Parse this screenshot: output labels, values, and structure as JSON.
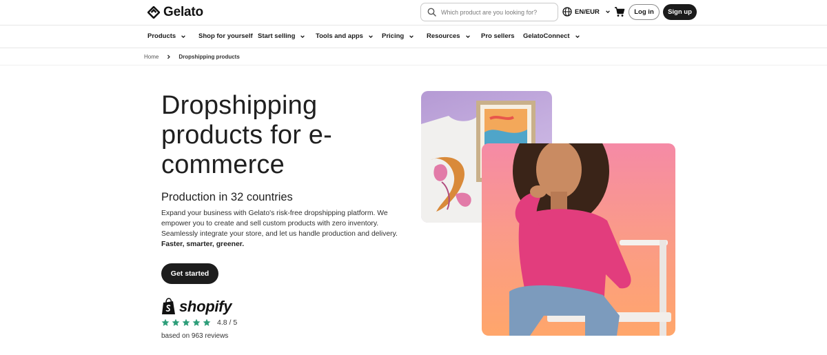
{
  "header": {
    "logo_text": "Gelato",
    "search_placeholder": "Which product are you looking for?",
    "language": "EN/EUR",
    "login_label": "Log in",
    "signup_label": "Sign up"
  },
  "nav": {
    "items": [
      {
        "label": "Products",
        "dropdown": true
      },
      {
        "label": "Shop for yourself",
        "dropdown": false
      },
      {
        "label": "Start selling",
        "dropdown": true
      },
      {
        "label": "Tools and apps",
        "dropdown": true
      },
      {
        "label": "Pricing",
        "dropdown": true
      },
      {
        "label": "Resources",
        "dropdown": true
      },
      {
        "label": "Pro sellers",
        "dropdown": false
      },
      {
        "label": "GelatoConnect",
        "dropdown": true
      }
    ]
  },
  "breadcrumb": {
    "home": "Home",
    "current": "Dropshipping products"
  },
  "hero": {
    "title": "Dropshipping products for e-commerce",
    "subtitle": "Production in 32 countries",
    "description": "Expand your business with Gelato's risk-free dropshipping platform. We empower you to create and sell custom products with zero inventory. Seamlessly integrate your store, and let us handle production and delivery.",
    "description_bold": "Faster, smarter, greener.",
    "cta_label": "Get started"
  },
  "reviews": {
    "brand": "shopify",
    "rating_value": 4.8,
    "rating_text": "4.8 / 5",
    "stars": 5,
    "count_text": "based on 963 reviews"
  },
  "colors": {
    "star": "#2e9e7a",
    "dark_button": "#1d1d1d",
    "shopify_bag": "#111111"
  },
  "icons": {
    "logo": "gelato-diamond-icon",
    "search": "search-icon",
    "language": "globe-icon",
    "cart": "cart-icon",
    "breadcrumb_separator": "chevron-right-icon",
    "dropdown": "chevron-down-icon",
    "shopify": "shopify-bag-icon",
    "star": "star-icon"
  }
}
